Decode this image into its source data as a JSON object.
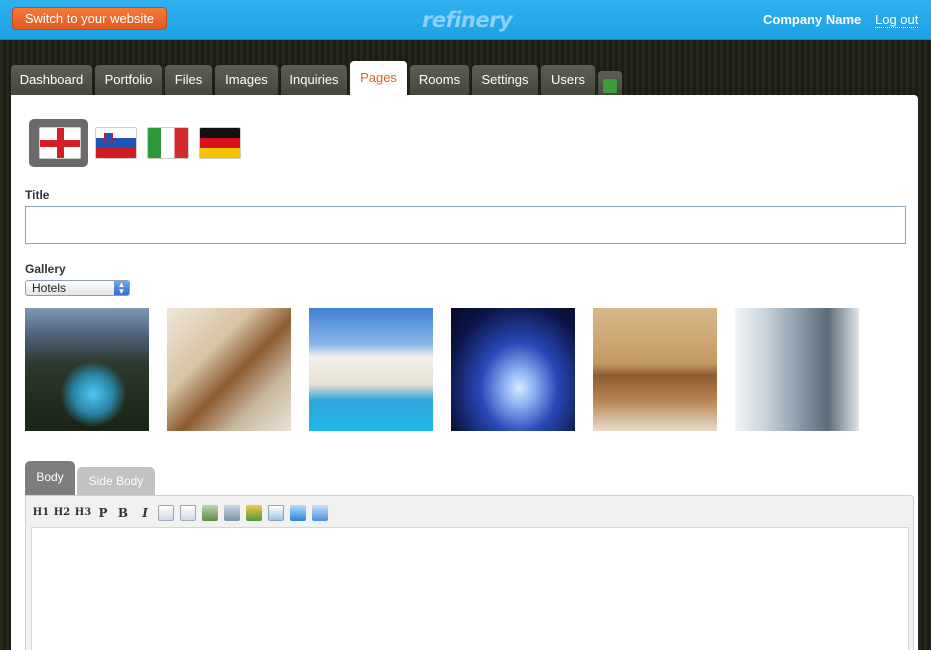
{
  "header": {
    "switch_label": "Switch to your website",
    "logo_text": "refinery",
    "company_name": "Company Name",
    "logout_label": "Log out"
  },
  "nav": {
    "tabs": [
      {
        "label": "Dashboard"
      },
      {
        "label": "Portfolio"
      },
      {
        "label": "Files"
      },
      {
        "label": "Images"
      },
      {
        "label": "Inquiries"
      },
      {
        "label": "Pages"
      },
      {
        "label": "Rooms"
      },
      {
        "label": "Settings"
      },
      {
        "label": "Users"
      }
    ],
    "active_tab": "Pages"
  },
  "locales": [
    {
      "name": "English",
      "flag": "england-flag-icon",
      "selected": true
    },
    {
      "name": "Slovenian",
      "flag": "slovenia-flag-icon",
      "selected": false
    },
    {
      "name": "Italian",
      "flag": "italy-flag-icon",
      "selected": false
    },
    {
      "name": "German",
      "flag": "germany-flag-icon",
      "selected": false
    }
  ],
  "form": {
    "title_label": "Title",
    "title_value": "",
    "gallery_label": "Gallery",
    "gallery_selected": "Hotels"
  },
  "gallery_images": [
    {
      "subject": "coastal town at night"
    },
    {
      "subject": "spiral staircase"
    },
    {
      "subject": "hotel with pool"
    },
    {
      "subject": "blue light burst"
    },
    {
      "subject": "hotel bedroom"
    },
    {
      "subject": "hooded figure on castle"
    }
  ],
  "editor": {
    "tabs": [
      {
        "label": "Body"
      },
      {
        "label": "Side Body"
      }
    ],
    "active_tab": "Body",
    "toolbar": {
      "h1": "H1",
      "h2": "H2",
      "h3": "H3",
      "p": "P",
      "bold": "B",
      "italic": "I"
    },
    "body_content": ""
  },
  "colors": {
    "topbar": "#22a8ea",
    "switch_button": "#e9621f",
    "active_tab_text": "#e06320"
  }
}
